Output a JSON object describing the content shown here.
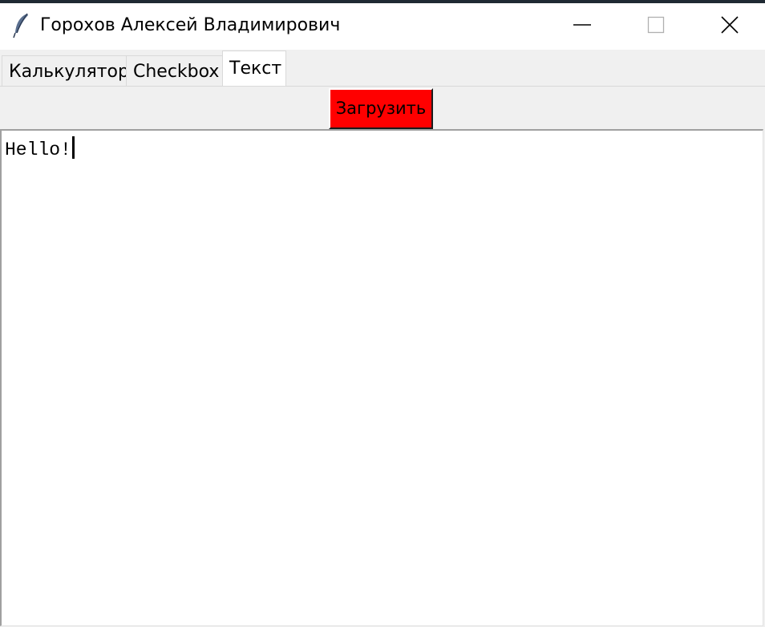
{
  "window": {
    "title": "Горохов Алексей Владимирович",
    "icons": {
      "app": "feather-icon",
      "minimize": "minimize-icon",
      "maximize": "maximize-icon",
      "close": "close-icon"
    }
  },
  "tabs": [
    {
      "label": "Калькулятор",
      "active": false
    },
    {
      "label": "Checkbox",
      "active": false
    },
    {
      "label": "Текст",
      "active": true
    }
  ],
  "text_tab": {
    "load_button_label": "Загрузить",
    "load_button_color": "#ff0000",
    "text_value": "Hello!"
  }
}
